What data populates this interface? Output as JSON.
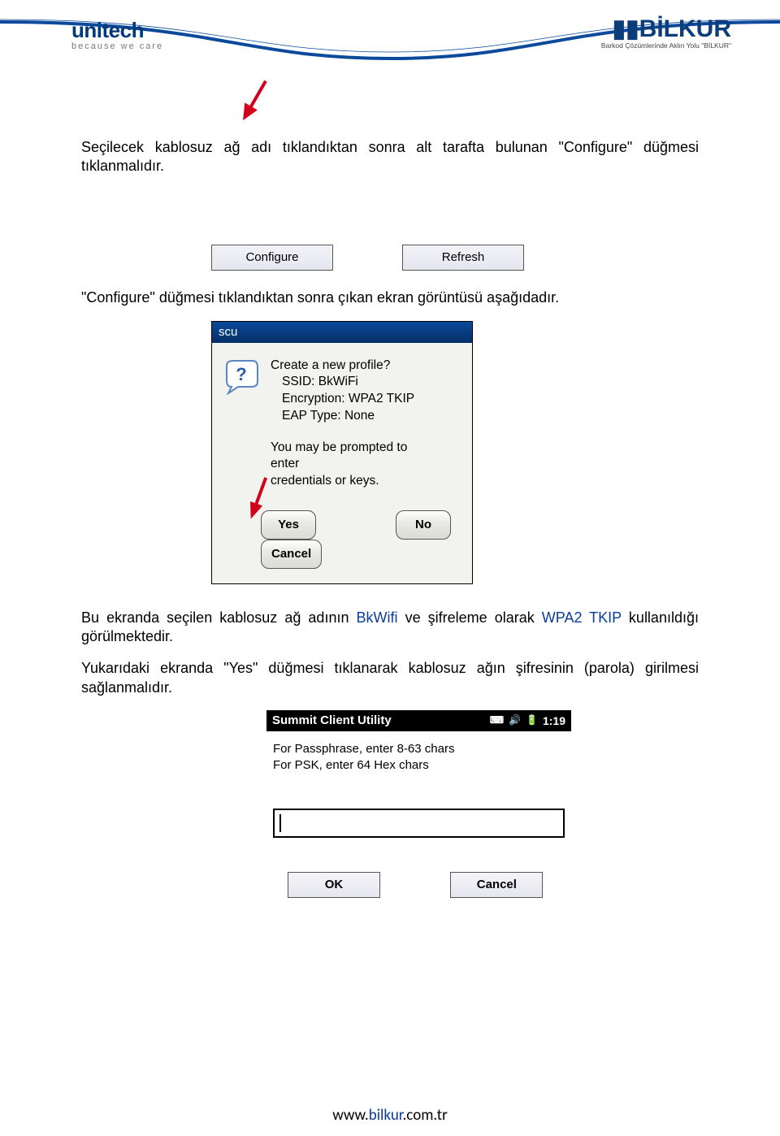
{
  "header": {
    "unitech_logo": "unitech",
    "unitech_tag": "because we care",
    "bilkur_logo": "▮▮BİLKUR",
    "bilkur_tag": "Barkod Çözümlerinde Aklın Yolu \"BİLKUR\""
  },
  "body": {
    "para1": "Seçilecek kablosuz ağ adı tıklandıktan sonra alt tarafta bulunan \"Configure\" düğmesi tıklanmalıdır.",
    "btn_configure": "Configure",
    "btn_refresh": "Refresh",
    "para2": "\"Configure\" düğmesi tıklandıktan sonra çıkan ekran görüntüsü aşağıdadır.",
    "dialog": {
      "title": "scu",
      "line1": "Create a new profile?",
      "line2": "SSID: BkWiFi",
      "line3": "Encryption: WPA2 TKIP",
      "line4": "EAP Type: None",
      "prompt1": "You may be prompted to",
      "prompt2": "enter",
      "prompt3": "credentials or keys.",
      "yes": "Yes",
      "no": "No",
      "cancel": "Cancel"
    },
    "para3a": "Bu ekranda seçilen kablosuz ağ adının ",
    "para3b": "BkWifi",
    "para3c": " ve şifreleme olarak ",
    "para3d": "WPA2 TKIP",
    "para3e": " kullanıldığı görülmektedir.",
    "para4": "Yukarıdaki ekranda \"Yes\" düğmesi tıklanarak kablosuz ağın şifresinin (parola) girilmesi sağlanmalıdır.",
    "summit": {
      "title": "Summit Client Utility",
      "time": "1:19",
      "hint1": "For Passphrase, enter 8-63 chars",
      "hint2": "For PSK, enter 64 Hex chars",
      "ok": "OK",
      "cancel": "Cancel"
    }
  },
  "footer": {
    "url_pre": "www.",
    "url_mid": "bilkur",
    "url_post": ".com.tr"
  }
}
